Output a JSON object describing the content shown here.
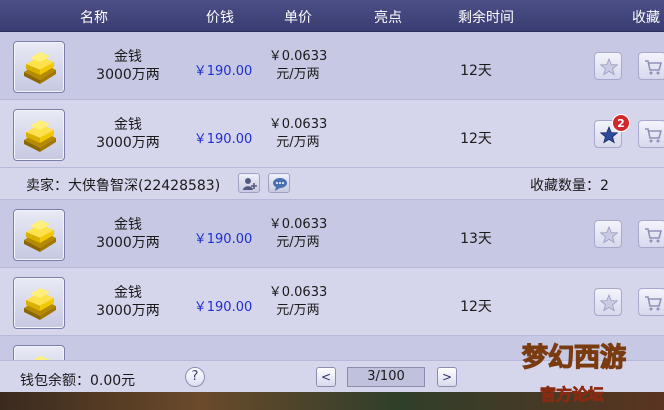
{
  "header": {
    "col_name": "名称",
    "col_price": "价钱",
    "col_unit": "单价",
    "col_highlight": "亮点",
    "col_remaining": "剩余时间",
    "col_favorite": "收藏"
  },
  "listings": [
    {
      "name": "金钱",
      "amount": "3000万两",
      "price": "￥190.00",
      "unit_price": "￥0.0633",
      "unit_suffix": "元/万两",
      "remaining": "12天",
      "fav_count_badge": null,
      "favorited": false
    },
    {
      "name": "金钱",
      "amount": "3000万两",
      "price": "￥190.00",
      "unit_price": "￥0.0633",
      "unit_suffix": "元/万两",
      "remaining": "12天",
      "fav_count_badge": "2",
      "favorited": true
    },
    {
      "name": "金钱",
      "amount": "3000万两",
      "price": "￥190.00",
      "unit_price": "￥0.0633",
      "unit_suffix": "元/万两",
      "remaining": "13天",
      "fav_count_badge": null,
      "favorited": false
    },
    {
      "name": "金钱",
      "amount": "3000万两",
      "price": "￥190.00",
      "unit_price": "￥0.0633",
      "unit_suffix": "元/万两",
      "remaining": "12天",
      "fav_count_badge": null,
      "favorited": false
    }
  ],
  "seller": {
    "label": "卖家：大侠鲁智深(22428583)",
    "fav_count_label": "收藏数量：2"
  },
  "footer": {
    "balance": "钱包余额：0.00元",
    "help": "?",
    "page_indicator": "3/100",
    "prev": "<",
    "next": ">"
  },
  "logo": {
    "text": "梦幻西游",
    "subtext": "官方论坛"
  },
  "colors": {
    "header_bg": "#3a3d72",
    "row_alt": "#c7c8e3",
    "row_plain": "#d5d6ec",
    "price_blue": "#1f2fd0",
    "badge_red": "#d2282c"
  },
  "icons": {
    "item": "gold-ingot-icon",
    "favorite": "star-icon",
    "cart": "cart-icon",
    "add_friend": "add-friend-icon",
    "chat": "chat-icon"
  }
}
